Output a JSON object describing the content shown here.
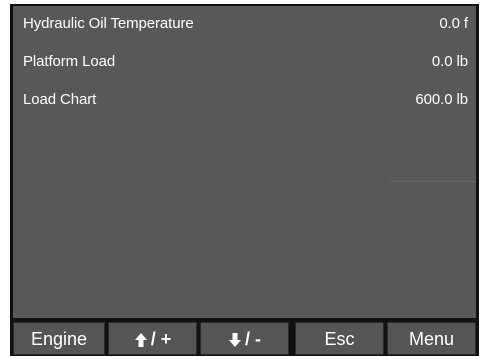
{
  "readouts": [
    {
      "label": "Hydraulic Oil Temperature",
      "value": "0.0 f"
    },
    {
      "label": "Platform Load",
      "value": "0.0 lb"
    },
    {
      "label": "Load Chart",
      "value": "600.0 lb"
    }
  ],
  "softkeys": {
    "engine": "Engine",
    "up": {
      "icon": "arrow-up-icon",
      "label": "/ +"
    },
    "down": {
      "icon": "arrow-down-icon",
      "label": "/ -"
    },
    "esc": "Esc",
    "menu": "Menu"
  },
  "colors": {
    "screen_bg": "#585858",
    "bezel": "#111111",
    "key_bg": "#555555",
    "text": "#ffffff"
  }
}
